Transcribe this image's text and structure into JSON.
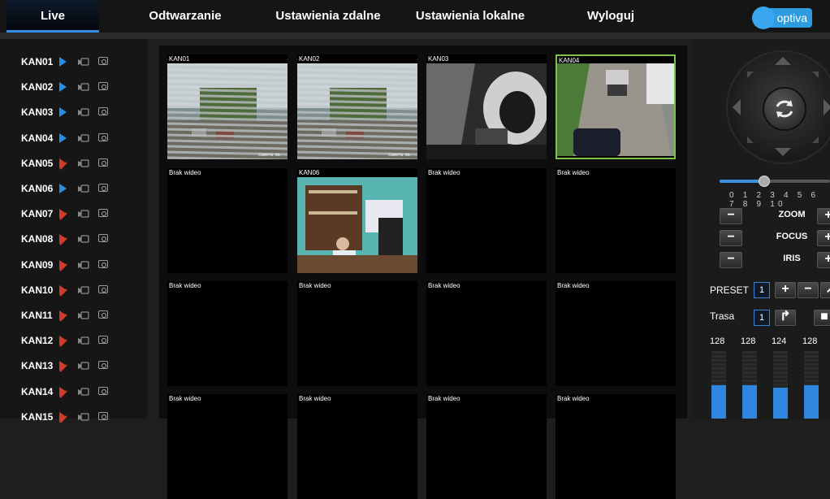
{
  "nav": {
    "tabs": [
      {
        "label": "Live",
        "active": true
      },
      {
        "label": "Odtwarzanie"
      },
      {
        "label": "Ustawienia zdalne"
      },
      {
        "label": "Ustawienia lokalne"
      },
      {
        "label": "Wyloguj"
      }
    ],
    "logo_text": "optiva"
  },
  "sidebar": {
    "channels": [
      {
        "name": "KAN01",
        "live": true
      },
      {
        "name": "KAN02",
        "live": true
      },
      {
        "name": "KAN03",
        "live": true
      },
      {
        "name": "KAN04",
        "live": true
      },
      {
        "name": "KAN05",
        "live": false
      },
      {
        "name": "KAN06",
        "live": true
      },
      {
        "name": "KAN07",
        "live": false
      },
      {
        "name": "KAN08",
        "live": false
      },
      {
        "name": "KAN09",
        "live": false
      },
      {
        "name": "KAN10",
        "live": false
      },
      {
        "name": "KAN11",
        "live": false
      },
      {
        "name": "KAN12",
        "live": false
      },
      {
        "name": "KAN13",
        "live": false
      },
      {
        "name": "KAN14",
        "live": false
      },
      {
        "name": "KAN15",
        "live": false
      }
    ]
  },
  "grid": {
    "cells": [
      {
        "label": "KAN01",
        "scene": "blinds",
        "overlay": "Camera 01"
      },
      {
        "label": "KAN02",
        "scene": "blinds",
        "overlay": "Camera 01"
      },
      {
        "label": "KAN03",
        "scene": "car"
      },
      {
        "label": "KAN04",
        "scene": "street",
        "selected": true
      },
      {
        "label": "Brak wideo"
      },
      {
        "label": "KAN06",
        "scene": "office"
      },
      {
        "label": "Brak wideo"
      },
      {
        "label": "Brak wideo"
      },
      {
        "label": "Brak wideo"
      },
      {
        "label": "Brak wideo"
      },
      {
        "label": "Brak wideo"
      },
      {
        "label": "Brak wideo"
      },
      {
        "label": "Brak wideo"
      },
      {
        "label": "Brak wideo"
      },
      {
        "label": "Brak wideo"
      },
      {
        "label": "Brak wideo"
      }
    ]
  },
  "ptz": {
    "speed_ticks": "0 1 2 3 4 5 6 7 8 9 10",
    "speed_value": 4,
    "zoom_label": "ZOOM",
    "focus_label": "FOCUS",
    "iris_label": "IRIS",
    "preset_label": "PRESET",
    "preset_value": "1",
    "trasa_label": "Trasa",
    "trasa_value": "1",
    "levels": [
      {
        "value": "128",
        "fraction": 0.5
      },
      {
        "value": "128",
        "fraction": 0.5
      },
      {
        "value": "124",
        "fraction": 0.46
      },
      {
        "value": "128",
        "fraction": 0.5
      }
    ]
  },
  "colors": {
    "accent": "#2f8fe6",
    "selected_border": "#7cc24b",
    "stopped": "#d23a2a"
  }
}
